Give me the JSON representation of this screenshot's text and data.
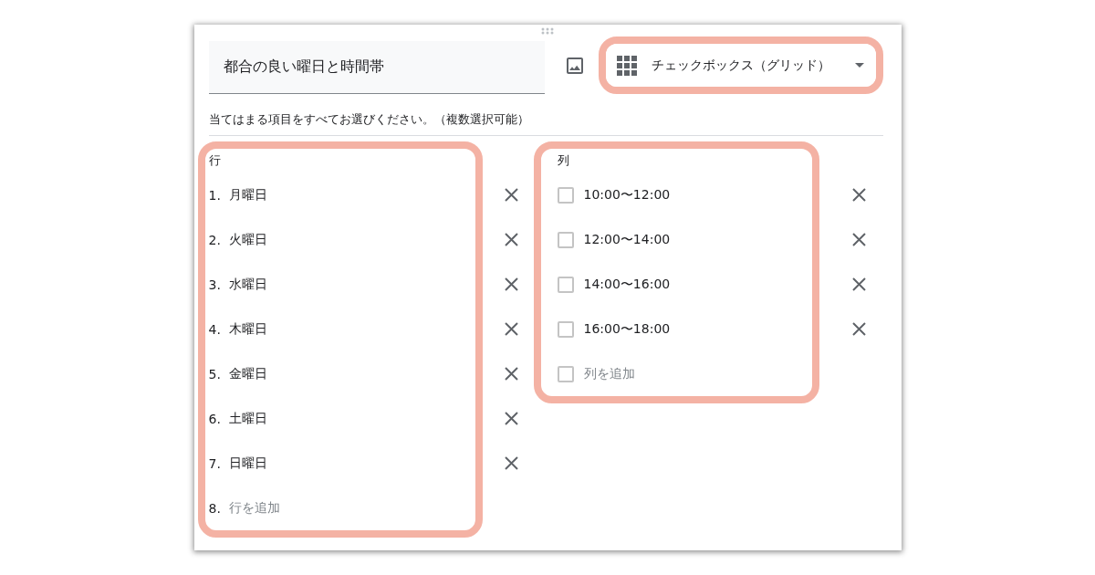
{
  "question": {
    "title": "都合の良い曜日と時間帯",
    "type": {
      "label": "チェックボックス（グリッド）",
      "highlighted": true
    },
    "description": "当てはまる項目をすべてお選びください。（複数選択可能）"
  },
  "rows": {
    "heading": "行",
    "highlighted": true,
    "items": [
      {
        "kind": "option",
        "number": "1.",
        "label": "月曜日"
      },
      {
        "kind": "option",
        "number": "2.",
        "label": "火曜日"
      },
      {
        "kind": "option",
        "number": "3.",
        "label": "水曜日"
      },
      {
        "kind": "option",
        "number": "4.",
        "label": "木曜日"
      },
      {
        "kind": "option",
        "number": "5.",
        "label": "金曜日"
      },
      {
        "kind": "option",
        "number": "6.",
        "label": "土曜日"
      },
      {
        "kind": "option",
        "number": "7.",
        "label": "日曜日"
      },
      {
        "kind": "add",
        "number": "8.",
        "placeholder": "行を追加"
      }
    ]
  },
  "columns": {
    "heading": "列",
    "highlighted": true,
    "items": [
      {
        "kind": "option",
        "label": "10:00〜12:00",
        "checked": false
      },
      {
        "kind": "option",
        "label": "12:00〜14:00",
        "checked": false
      },
      {
        "kind": "option",
        "label": "14:00〜16:00",
        "checked": false
      },
      {
        "kind": "option",
        "label": "16:00〜18:00",
        "checked": false
      },
      {
        "kind": "add",
        "placeholder": "列を追加",
        "checked": false
      }
    ]
  }
}
